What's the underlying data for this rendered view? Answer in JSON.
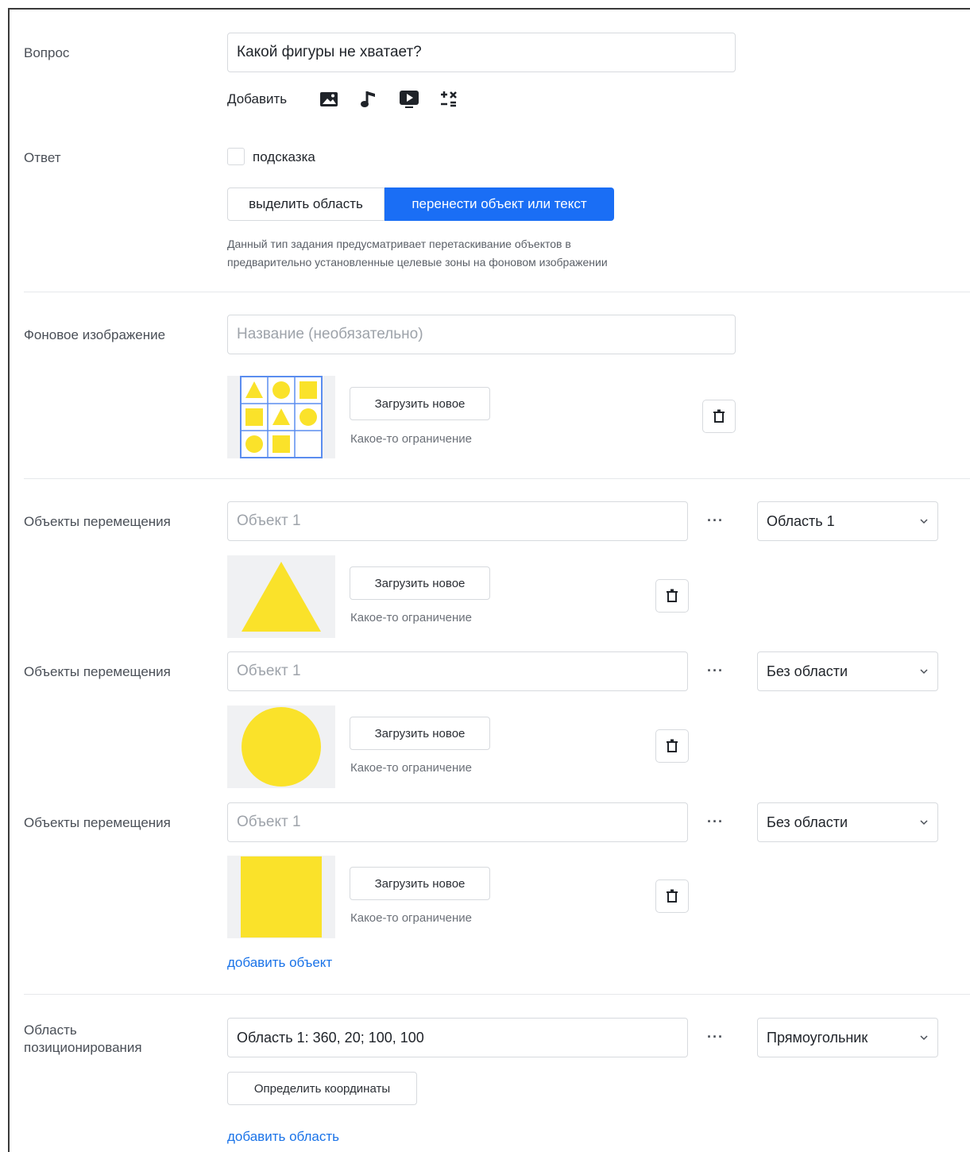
{
  "question": {
    "label": "Вопрос",
    "value": "Какой фигуры не хватает?",
    "add_label": "Добавить",
    "add_icons": [
      "image-icon",
      "music-note-icon",
      "video-icon",
      "formula-icon"
    ]
  },
  "answer": {
    "label": "Ответ",
    "hint_checkbox_label": "подсказка",
    "hint_checked": false,
    "modes": [
      "выделить область",
      "перенести объект или текст"
    ],
    "active_mode": "перенести объект или текст",
    "description_line1": "Данный тип задания предусматривает перетаскивание объектов  в",
    "description_line2": "предварительно установленные целевые зоны на фоновом изображении"
  },
  "background": {
    "label": "Фоновое изображение",
    "name_placeholder": "Название (необязательно)",
    "upload_label": "Загрузить новое",
    "restriction": "Какое-то ограничение",
    "grid": [
      "triangle",
      "circle",
      "square",
      "square",
      "triangle",
      "circle",
      "circle",
      "square",
      "empty"
    ]
  },
  "objects": [
    {
      "label": "Объекты перемещения",
      "placeholder": "Объект 1",
      "area": "Область 1",
      "shape": "triangle",
      "upload_label": "Загрузить новое",
      "restriction": "Какое-то ограничение"
    },
    {
      "label": "Объекты перемещения",
      "placeholder": "Объект 1",
      "area": "Без области",
      "shape": "circle",
      "upload_label": "Загрузить новое",
      "restriction": "Какое-то ограничение"
    },
    {
      "label": "Объекты перемещения",
      "placeholder": "Объект 1",
      "area": "Без области",
      "shape": "square",
      "upload_label": "Загрузить новое",
      "restriction": "Какое-то ограничение"
    }
  ],
  "add_object_link": "добавить объект",
  "positioning": {
    "label_line1": "Область",
    "label_line2": "позиционирования",
    "value": "Область 1: 360, 20; 100, 100",
    "shape_type": "Прямоугольник",
    "define_button": "Определить координаты",
    "add_area_link": "добавить область"
  },
  "more_label": "···",
  "colors": {
    "accent": "#1a6ef5",
    "link": "#1a73e8",
    "shape_yellow": "#fae22a",
    "grid_blue": "#5b8def"
  }
}
